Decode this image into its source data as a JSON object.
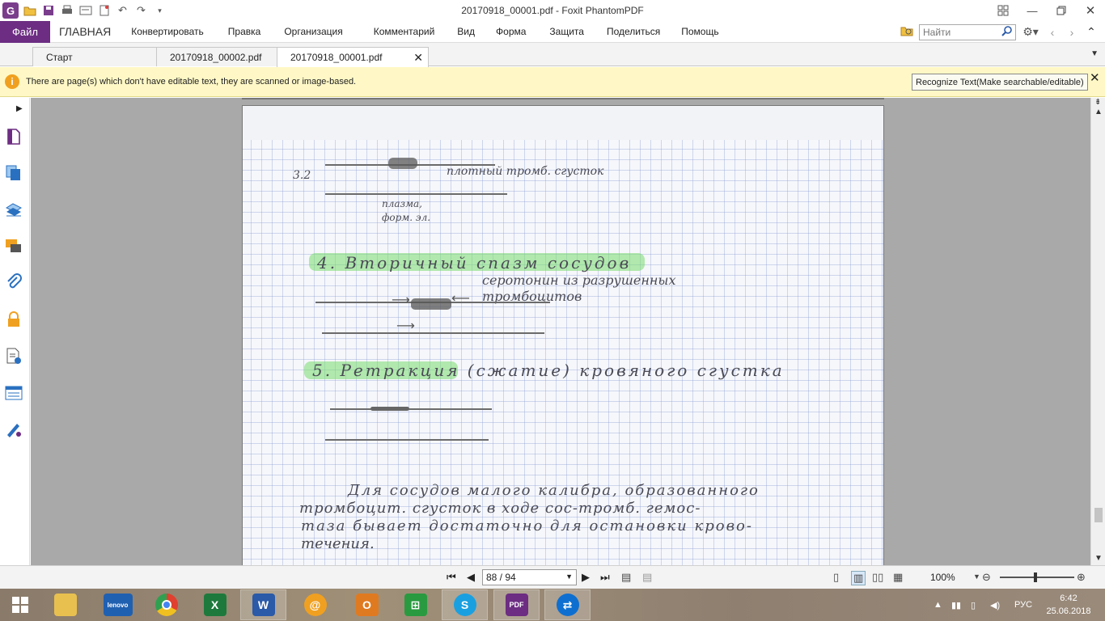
{
  "window": {
    "title": "20170918_00001.pdf - Foxit PhantomPDF"
  },
  "menu": {
    "file": "Файл",
    "items": [
      "ГЛАВНАЯ",
      "Конвертировать",
      "Правка",
      "Организация",
      "Комментарий",
      "Вид",
      "Форма",
      "Защита",
      "Поделиться",
      "Помощь"
    ],
    "search_placeholder": "Найти"
  },
  "tabs": [
    "Старт",
    "20170918_00002.pdf",
    "20170918_00001.pdf"
  ],
  "notification": {
    "message": "There are page(s) which don't have editable text, they are scanned or image-based.",
    "button": "Recognize Text(Make searchable/editable)"
  },
  "sidebar": {
    "icons": [
      "page-thumbnails-icon",
      "layers-icon",
      "bookmarks-icon",
      "comments-icon",
      "attachments-icon",
      "security-icon",
      "file-properties-icon",
      "content-icon",
      "signature-icon"
    ]
  },
  "page_content": {
    "lines": [
      "3.2",
      "плотный тромб. сгусток",
      "плазма, форм. эл.",
      "4. Вторичный спазм сосудов",
      "серотонин из разрушенных тромбоцитов",
      "5. Ретракция (сжатие) кровяного сгустка",
      "Для сосудов малого калибра, образованного",
      "тромбоцит. сгусток в ходе сос-тромб. гемос-",
      "таза бывает достаточно для остановки крово-",
      "течения."
    ]
  },
  "status": {
    "page_field": "88 / 94",
    "zoom": "100%"
  },
  "taskbar": {
    "apps": [
      "explorer",
      "lenovo",
      "chrome",
      "excel",
      "word",
      "mail",
      "outlook",
      "store",
      "skype",
      "foxit-pdf",
      "teamviewer"
    ],
    "lang": "РУС",
    "time": "6:42",
    "date": "25.06.2018"
  }
}
